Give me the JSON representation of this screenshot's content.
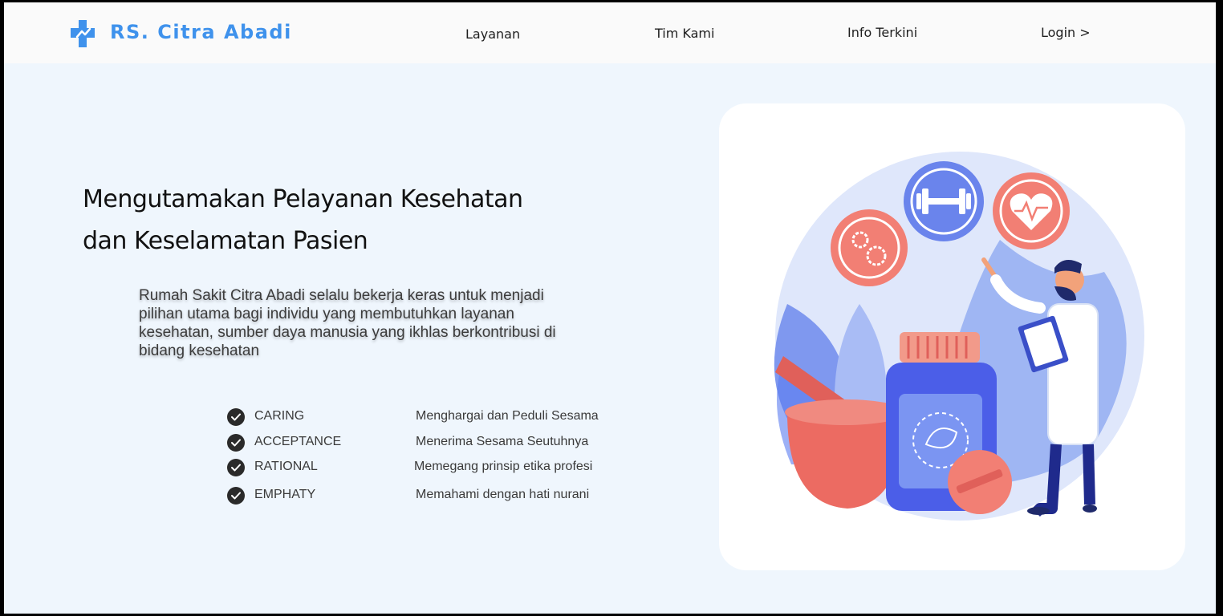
{
  "header": {
    "brand": "RS. Citra Abadi",
    "logo_icon": "medical-cross-icon",
    "brand_color": "#3f92ec",
    "nav": [
      {
        "label": "Layanan"
      },
      {
        "label": "Tim Kami"
      },
      {
        "label": "Info Terkini"
      },
      {
        "label": "Login >"
      }
    ]
  },
  "hero": {
    "headline_line1": "Mengutamakan Pelayanan Kesehatan",
    "headline_line2": "dan Keselamatan Pasien",
    "description": "Rumah Sakit Citra Abadi selalu bekerja keras untuk menjadi pilihan utama bagi individu yang membutuhkan layanan kesehatan, sumber daya manusia yang ikhlas berkontribusi di bidang kesehatan",
    "values": [
      {
        "name": "CARING",
        "desc": "Menghargai dan Peduli Sesama",
        "icon": "check-circle-icon"
      },
      {
        "name": "ACCEPTANCE",
        "desc": "Menerima Sesama Seutuhnya",
        "icon": "check-circle-icon"
      },
      {
        "name": "RATIONAL",
        "desc": "Memegang prinsip etika profesi",
        "icon": "check-circle-icon"
      },
      {
        "name": "EMPHATY",
        "desc": "Memahami dengan hati nurani",
        "icon": "check-circle-icon"
      }
    ]
  },
  "illustration": {
    "description_icon": "doctor-medicine-illustration",
    "colors": {
      "accent_blue": "#5a7cf0",
      "coral": "#f2746b",
      "background": "#eff6fd"
    }
  }
}
